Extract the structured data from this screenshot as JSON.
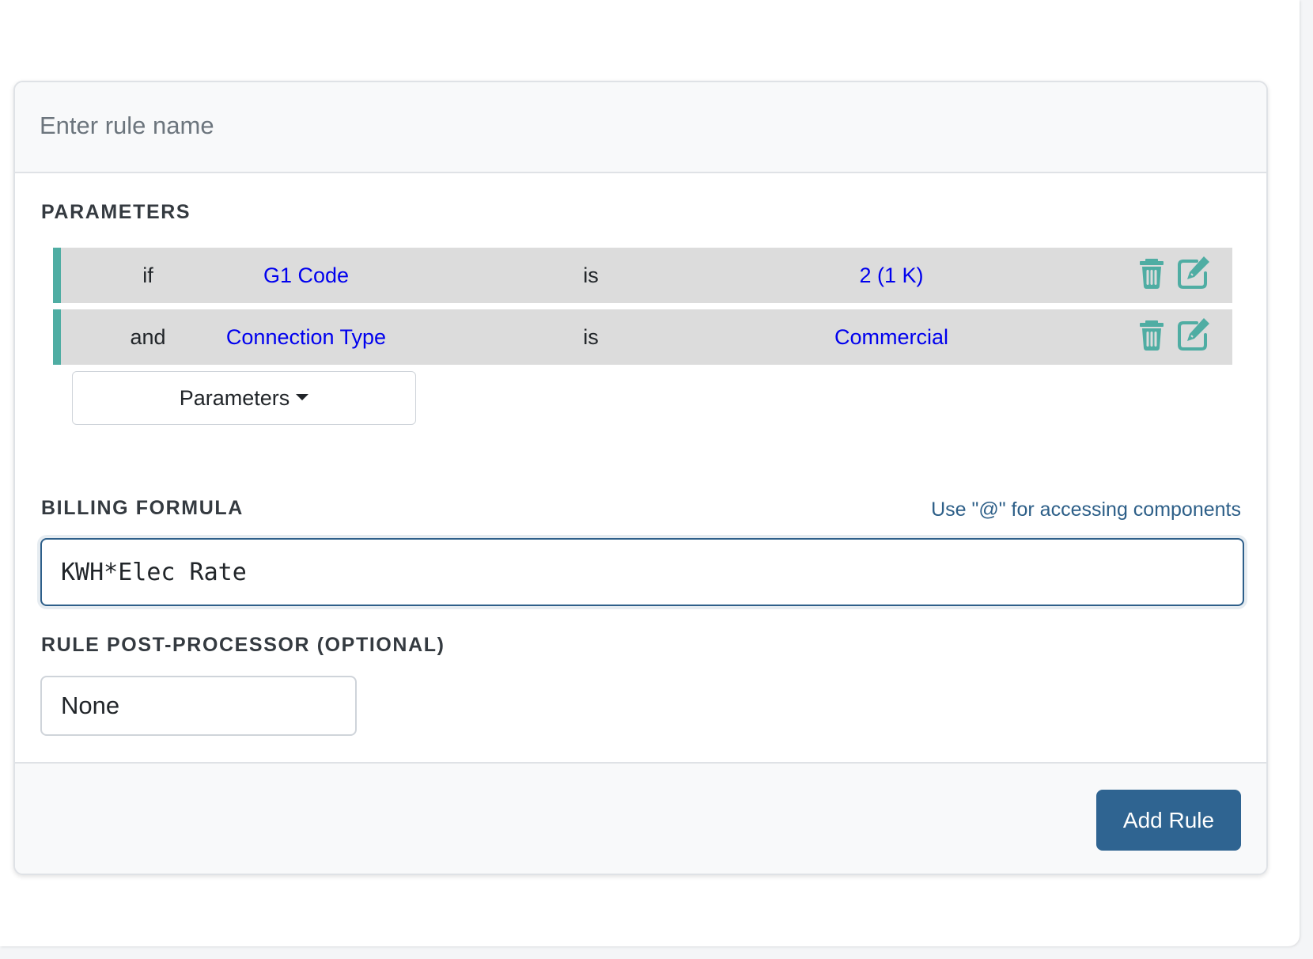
{
  "rule": {
    "name_placeholder": "Enter rule name"
  },
  "parameters": {
    "title": "PARAMETERS",
    "rows": [
      {
        "connector": "if",
        "field": "G1 Code",
        "operator": "is",
        "value": "2 (1 K)"
      },
      {
        "connector": "and",
        "field": "Connection Type",
        "operator": "is",
        "value": "Commercial"
      }
    ],
    "dropdown_label": "Parameters"
  },
  "billing": {
    "title": "BILLING FORMULA",
    "hint": "Use \"@\" for accessing components",
    "formula_value": "KWH*Elec Rate"
  },
  "post_processor": {
    "title": "RULE POST-PROCESSOR (OPTIONAL)",
    "selected": "None"
  },
  "footer": {
    "add_label": "Add Rule"
  },
  "icons": {
    "row_delete": "trash-icon",
    "row_edit": "edit-icon",
    "dropdown": "caret-down-icon"
  },
  "colors": {
    "accent_teal": "#4fada3",
    "link_blue": "#0000ee",
    "primary_button": "#2f6491",
    "hint_text": "#2d5f88"
  }
}
